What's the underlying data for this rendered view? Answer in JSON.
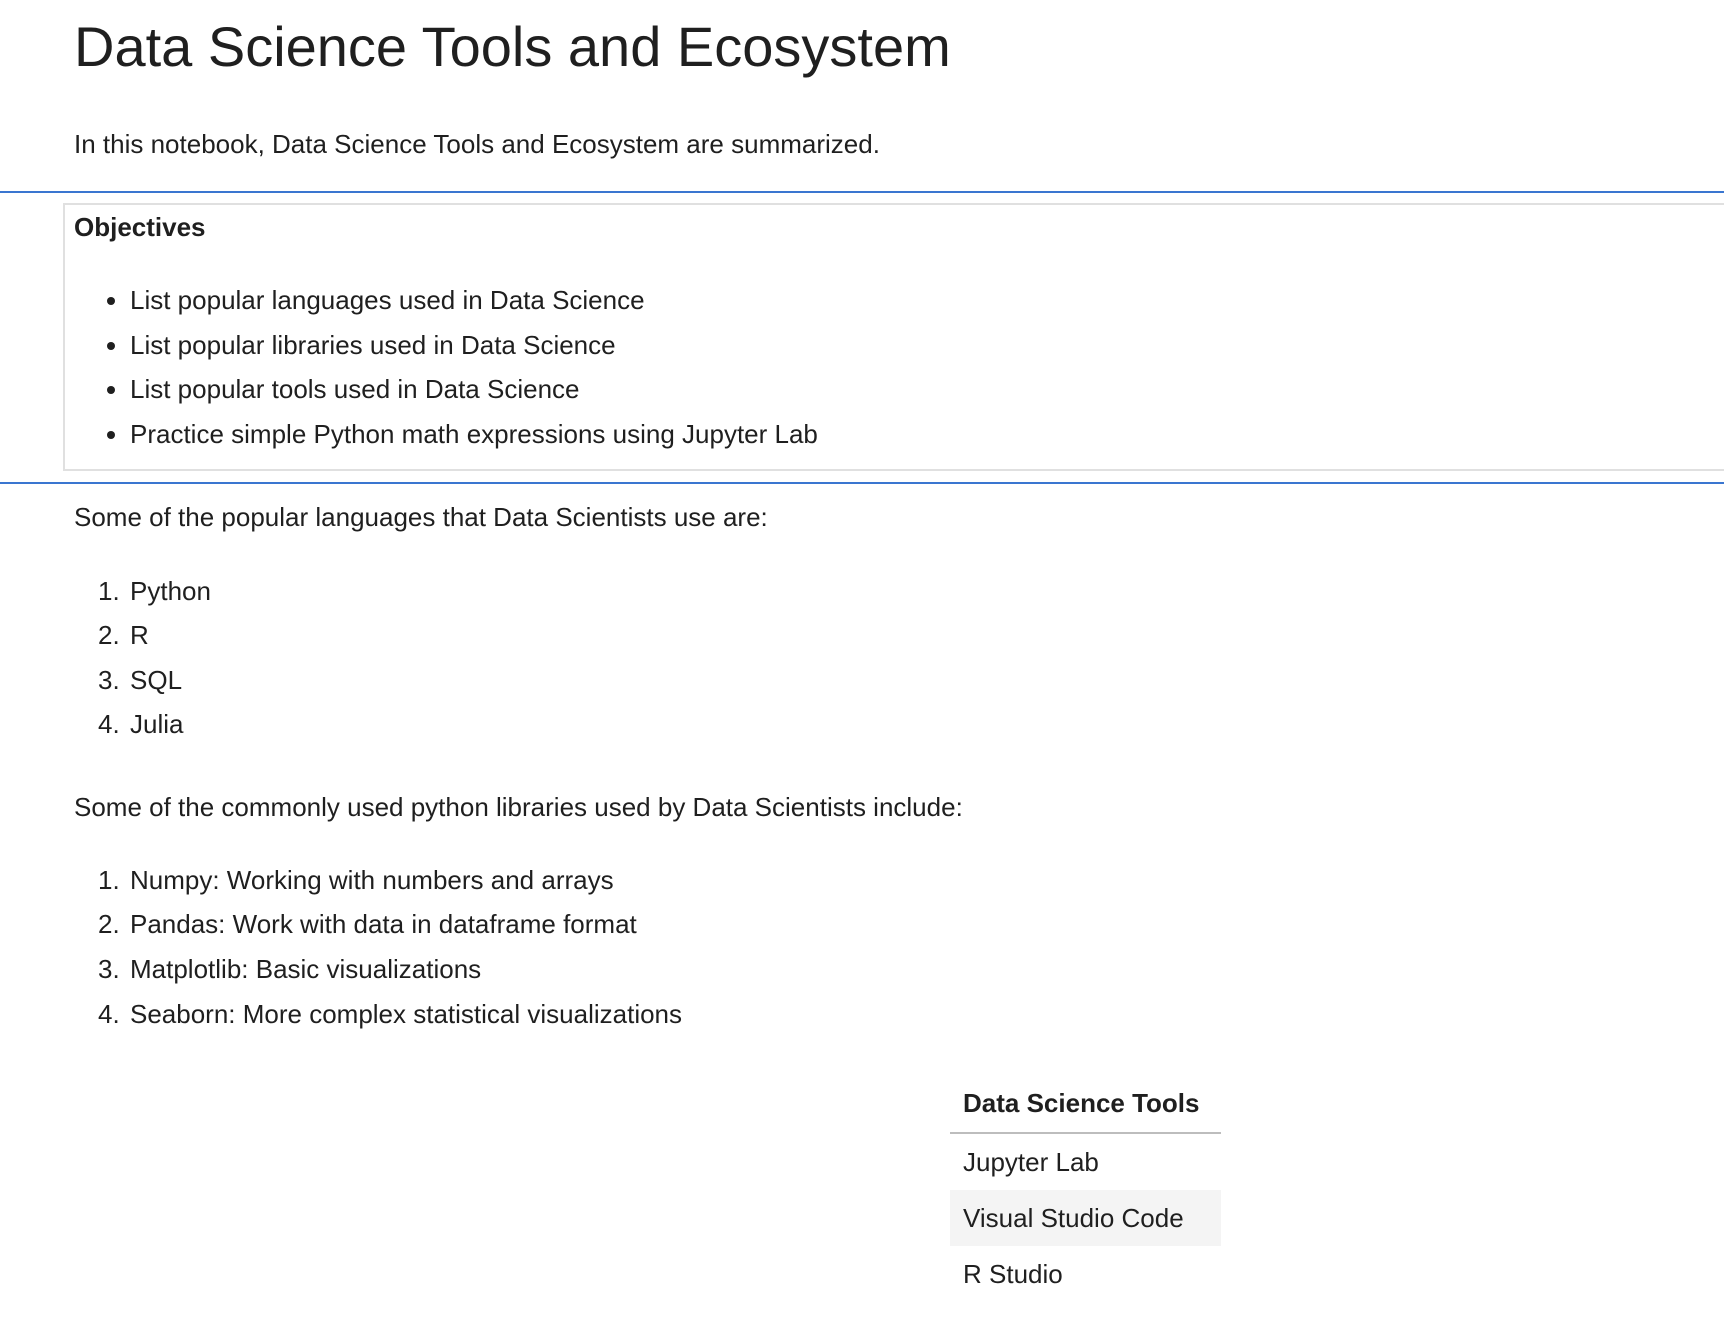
{
  "title": "Data Science Tools and Ecosystem",
  "intro": "In this notebook, Data Science Tools and Ecosystem are summarized.",
  "objectives": {
    "heading": "Objectives",
    "items": [
      "List popular languages used in Data Science",
      "List popular libraries used in Data Science",
      "List popular tools used in Data Science",
      "Practice simple Python math expressions using Jupyter Lab"
    ]
  },
  "languages": {
    "intro": "Some of the popular languages that Data Scientists use are:",
    "items": [
      "Python",
      "R",
      "SQL",
      "Julia"
    ]
  },
  "libraries": {
    "intro": "Some of the commonly used python libraries used by Data Scientists include:",
    "items": [
      "Numpy: Working with numbers and arrays",
      "Pandas: Work with data in dataframe format",
      "Matplotlib: Basic visualizations",
      "Seaborn: More complex statistical visualizations"
    ]
  },
  "tools_table": {
    "header": "Data Science Tools",
    "rows": [
      "Jupyter Lab",
      "Visual Studio Code",
      "R Studio"
    ]
  }
}
